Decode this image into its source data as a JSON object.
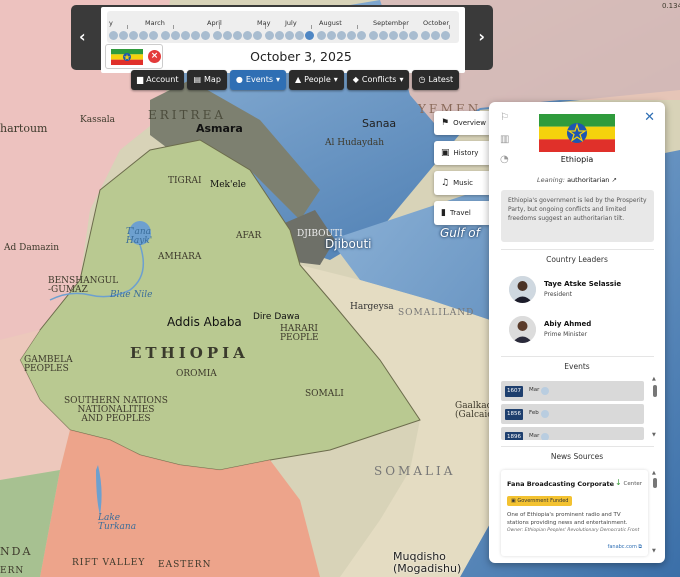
{
  "timeline": {
    "months": [
      "y",
      "March",
      "April",
      "May",
      "July",
      "August",
      "September",
      "October"
    ],
    "date": "October 3, 2025",
    "prev_arrow": "‹",
    "next_arrow": "›",
    "clear_icon": "×"
  },
  "nav": [
    {
      "icon": "▆",
      "label": "Account",
      "dropdown": false
    },
    {
      "icon": "▤",
      "label": "Map",
      "dropdown": false
    },
    {
      "icon": "●",
      "label": "Events",
      "dropdown": true,
      "active": true
    },
    {
      "icon": "▲",
      "label": "People",
      "dropdown": true
    },
    {
      "icon": "◆",
      "label": "Conflicts",
      "dropdown": true
    },
    {
      "icon": "◷",
      "label": "Latest",
      "dropdown": false
    }
  ],
  "side_tabs": [
    {
      "icon": "⚑",
      "label": "Overview"
    },
    {
      "icon": "▣",
      "label": "History"
    },
    {
      "icon": "♫",
      "label": "Music"
    },
    {
      "icon": "▮",
      "label": "Travel"
    }
  ],
  "panel": {
    "close_icon": "✕",
    "side_icons": [
      "⚐",
      "▥",
      "◔"
    ],
    "country": "Ethiopia",
    "leaning_label": "Leaning:",
    "leaning_value": "authoritarian",
    "leaning_icon": "↗",
    "description": "Ethiopia's government is led by the Prosperity Party, but ongoing conflicts and limited freedoms suggest an authoritarian tilt.",
    "leaders_title": "Country Leaders",
    "leaders": [
      {
        "name": "Taye Atske Selassie",
        "role": "President"
      },
      {
        "name": "Abiy Ahmed",
        "role": "Prime Minister"
      }
    ],
    "events_title": "Events",
    "events": [
      {
        "year": "1607",
        "month": "Mar"
      },
      {
        "year": "1856",
        "month": "Feb"
      },
      {
        "year": "1896",
        "month": "Mar"
      }
    ],
    "news_title": "News Sources",
    "news": {
      "name": "Fana Broadcasting Corporate",
      "lean": "Center",
      "lean_icon": "↓",
      "badge": "Government Funded",
      "badge_icon": "▣",
      "description": "One of Ethiopia's prominent radio and TV stations providing news and entertainment.",
      "owner": "Owner: Ethiopian Peoples' Revolutionary Democratic Front",
      "link": "fanabc.com",
      "link_icon": "⧉"
    },
    "scroll_up": "▲",
    "scroll_down": "▼"
  },
  "map": {
    "labels": {
      "khartoum": "hartoum",
      "kassala": "Kassala",
      "eritrea": "ERITREA",
      "asmara": "Asmara",
      "yemen": "YEMEN",
      "sanaa": "Sanaa",
      "alhudaydah": "Al Hudaydah",
      "tigray": "TIGRAI",
      "mekele": "Mek'ele",
      "afar": "AFAR",
      "tana": "T'ana\nHayk'",
      "amhara": "AMHARA",
      "djibouti_region": "DJIBOUTI",
      "djibouti": "Djibouti",
      "gulf": "Gulf of",
      "addamazin": "Ad Damazin",
      "benshangul": "BENSHANGUL\n-GUMAZ",
      "bluenile": "Blue Nile",
      "addis": "Addis Ababa",
      "diredawa": "Dire Dawa",
      "harari": "HARARI\nPEOPLE",
      "hargeysa": "Hargeysa",
      "somaliland": "SOMALILAND",
      "ethiopia": "ETHIOPIA",
      "gambela": "GAMBELA\nPEOPLES",
      "oromia": "OROMIA",
      "somali": "SOMALI",
      "snnp": "SOUTHERN NATIONS\nNATIONALITIES\nAND PEOPLES",
      "gaalkacyo": "Gaalkacyo\n(Galcaio)",
      "somalia": "SOMALIA",
      "turkana": "Lake\nTurkana",
      "rift": "RIFT VALLEY",
      "eastern": "EASTERN",
      "muqdisho": "Muqdisho\n(Mogadishu)",
      "nda": "NDA",
      "ern": "ERN",
      "coord": "0.134"
    }
  }
}
